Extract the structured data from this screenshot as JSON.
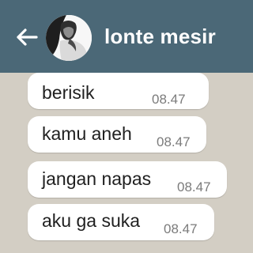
{
  "header": {
    "title": "lonte mesir",
    "back_icon": "arrow-left-icon",
    "avatar_icon": "contact-avatar",
    "background": "#4b6877"
  },
  "messages": [
    {
      "text": "berisik",
      "time": "08.47"
    },
    {
      "text": "kamu aneh",
      "time": "08.47"
    },
    {
      "text": "jangan napas",
      "time": "08.47"
    },
    {
      "text": "aku ga suka",
      "time": "08.47"
    }
  ],
  "colors": {
    "bubble": "#ffffff",
    "chat_background": "#d3cec4",
    "time_text": "#7b7b7b"
  }
}
